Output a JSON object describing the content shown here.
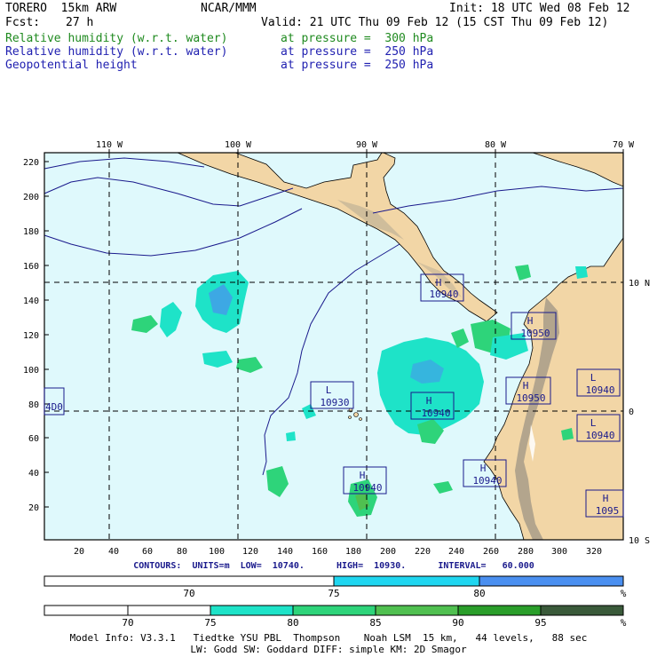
{
  "header": {
    "model": "TORERO  15km ARW",
    "org": "NCAR/MMM",
    "init": "Init: 18 UTC Wed 08 Feb 12",
    "fcst_label": "Fcst:",
    "fcst_value": "27 h",
    "valid": "Valid: 21 UTC Thu 09 Feb 12 (15 CST Thu 09 Feb 12)",
    "fields": [
      {
        "name": "Relative humidity (w.r.t. water)",
        "level": "at pressure =  300 hPa",
        "color": "#1f8a1f"
      },
      {
        "name": "Relative humidity (w.r.t. water)",
        "level": "at pressure =  250 hPa",
        "color": "#1f1fb0"
      },
      {
        "name": "Geopotential height",
        "level": "at pressure =  250 hPa",
        "color": "#1f1fb0"
      }
    ]
  },
  "map": {
    "lon_labels": [
      "110 W",
      "100 W",
      "90 W",
      "80 W",
      "70 W"
    ],
    "lat_labels": [
      "10 N",
      "0",
      "10 S"
    ],
    "y_ticks": [
      "220",
      "200",
      "180",
      "160",
      "140",
      "120",
      "100",
      "80",
      "60",
      "40",
      "20"
    ],
    "x_ticks": [
      "20",
      "40",
      "60",
      "80",
      "100",
      "120",
      "140",
      "160",
      "180",
      "200",
      "220",
      "240",
      "260",
      "280",
      "300",
      "320"
    ],
    "centers": [
      {
        "type": "H",
        "value": "10940"
      },
      {
        "type": "H",
        "value": "10950"
      },
      {
        "type": "L",
        "value": "10930"
      },
      {
        "type": "H",
        "value": "10940"
      },
      {
        "type": "H",
        "value": "10950"
      },
      {
        "type": "L",
        "value": "10940"
      },
      {
        "type": "L",
        "value": "10940"
      },
      {
        "type": "H",
        "value": "10940"
      },
      {
        "type": "H",
        "value": "10940"
      },
      {
        "type": "H",
        "value": "1095"
      },
      {
        "type": "",
        "value": "4D0"
      }
    ],
    "colors": {
      "ocean": "#dff9fc",
      "land": "#f2d6a6",
      "frame": "#000000"
    }
  },
  "contours": "CONTOURS:  UNITS=m  LOW=  10740.      HIGH=  10930.      INTERVAL=   60.000",
  "bar1": {
    "labels": [
      "70",
      "75",
      "80",
      "%"
    ],
    "colors": [
      "#ffffff",
      "#1fd6f0",
      "#4a8ff0"
    ]
  },
  "bar2": {
    "labels": [
      "70",
      "75",
      "80",
      "85",
      "90",
      "95",
      "%"
    ],
    "colors": [
      "#ffffff",
      "#ffffff",
      "#1ee3c8",
      "#2ed47a",
      "#50c050",
      "#2a9e2a",
      "#3a5a3a"
    ]
  },
  "model_info": {
    "line1": "Model Info: V3.3.1   Tiedtke YSU PBL  Thompson    Noah LSM  15 km,   44 levels,   88 sec",
    "line2": "LW: Godd SW: Goddard DIFF: simple KM: 2D Smagor"
  }
}
